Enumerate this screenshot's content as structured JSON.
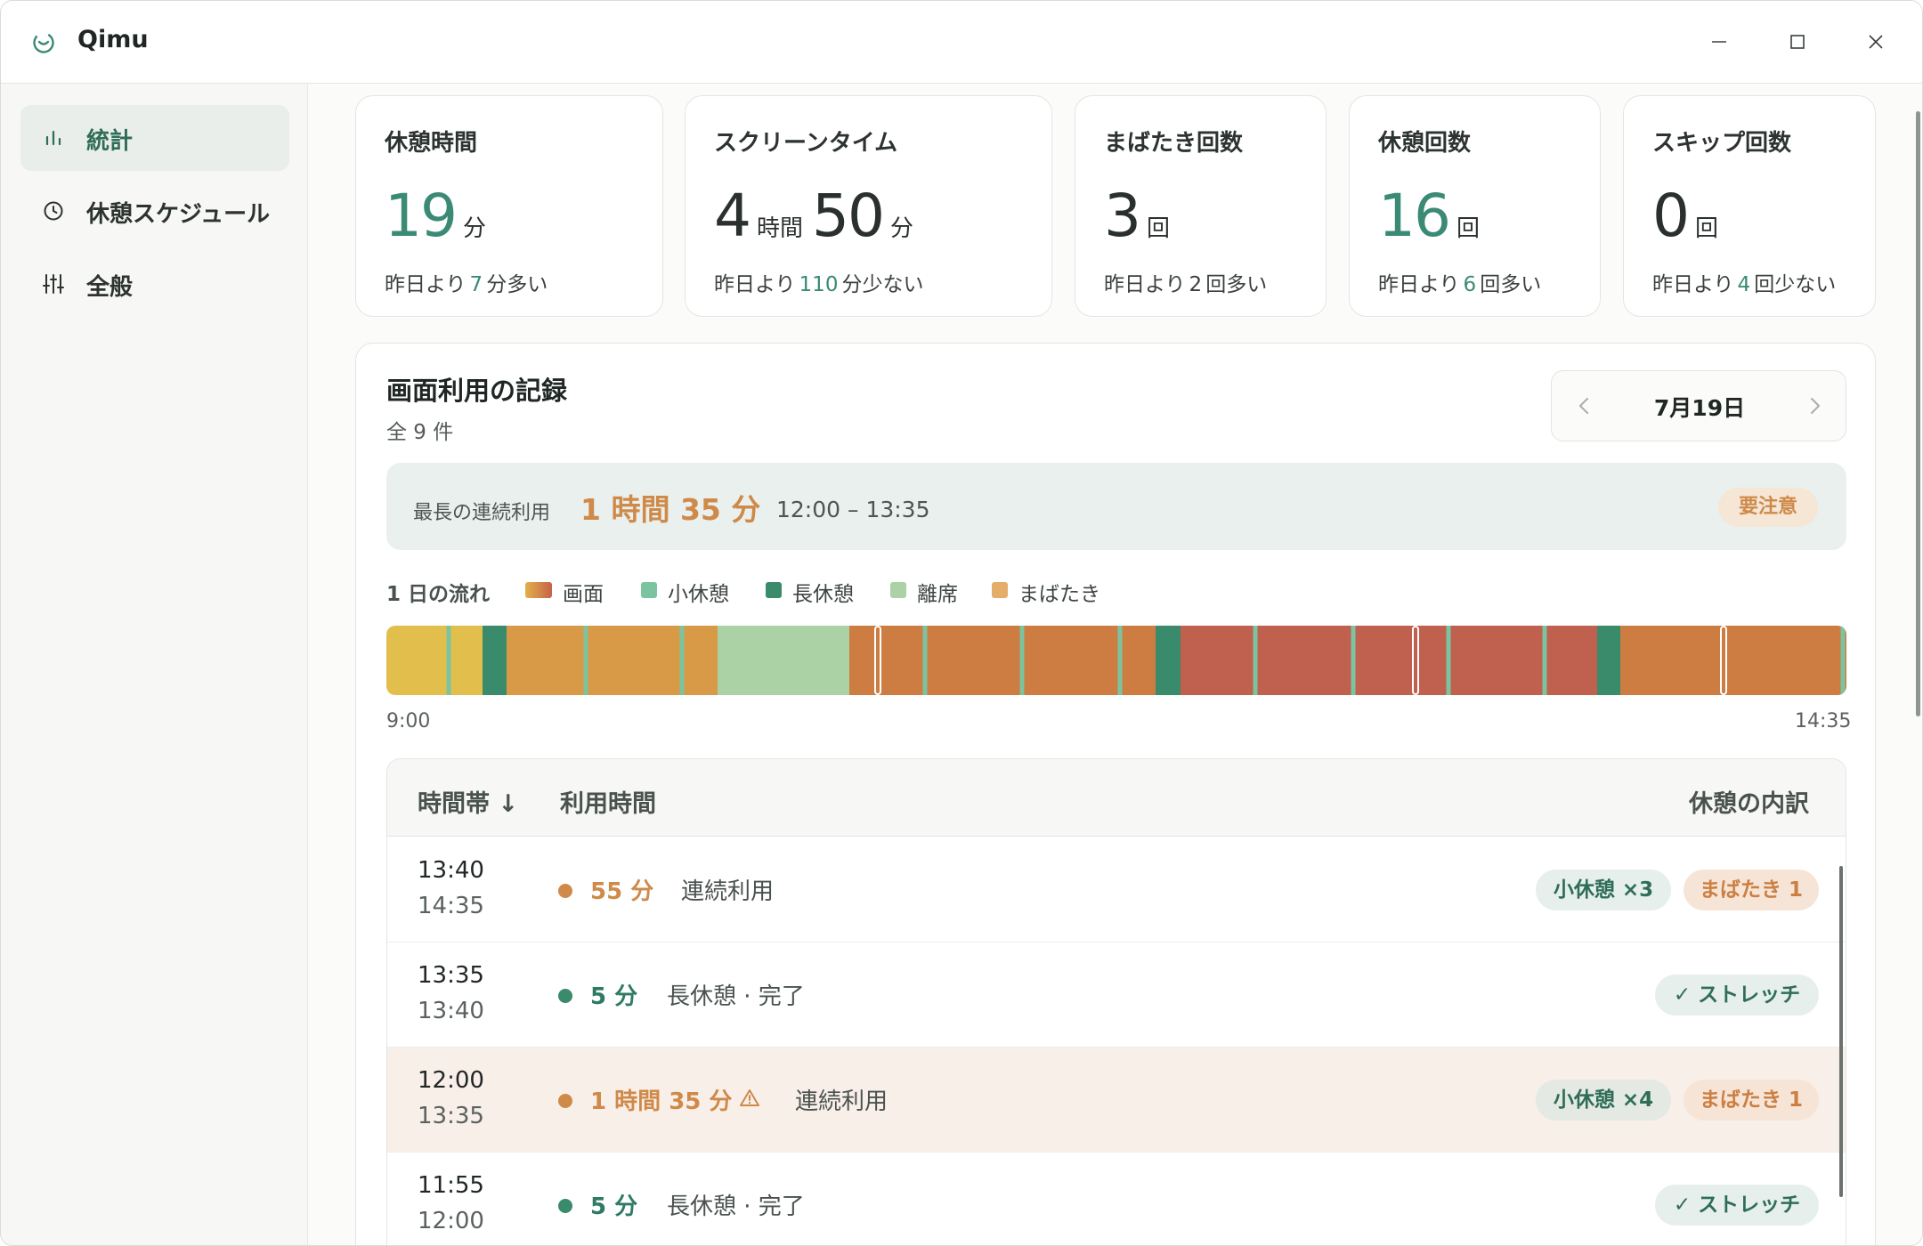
{
  "app": {
    "title": "Qimu"
  },
  "sidebar": {
    "items": [
      {
        "label": "統計",
        "icon": "bar-chart-icon",
        "active": true
      },
      {
        "label": "休憩スケジュール",
        "icon": "clock-icon",
        "active": false
      },
      {
        "label": "全般",
        "icon": "sliders-icon",
        "active": false
      }
    ]
  },
  "stats": [
    {
      "title": "休憩時間",
      "values": [
        {
          "num": "19",
          "unit": "分",
          "accent": true
        }
      ],
      "diff_prefix": "昨日より",
      "diff_value": "7",
      "diff_suffix": "分多い"
    },
    {
      "title": "スクリーンタイム",
      "values": [
        {
          "num": "4",
          "unit": "時間"
        },
        {
          "num": "50",
          "unit": "分"
        }
      ],
      "diff_prefix": "昨日より",
      "diff_value": "110",
      "diff_suffix": "分少ない"
    },
    {
      "title": "まばたき回数",
      "values": [
        {
          "num": "3",
          "unit": "回"
        }
      ],
      "diff_prefix": "昨日より",
      "diff_value": "2",
      "diff_suffix": "回多い"
    },
    {
      "title": "休憩回数",
      "values": [
        {
          "num": "16",
          "unit": "回",
          "accent": true
        }
      ],
      "diff_prefix": "昨日より",
      "diff_value": "6",
      "diff_suffix": "回多い"
    },
    {
      "title": "スキップ回数",
      "values": [
        {
          "num": "0",
          "unit": "回"
        }
      ],
      "diff_prefix": "昨日より",
      "diff_value": "4",
      "diff_suffix": "回少ない"
    }
  ],
  "record": {
    "title": "画面利用の記録",
    "count": "全 9 件",
    "date": "7月19日",
    "longest": {
      "label": "最長の連続利用",
      "value": "1 時間 35 分",
      "range": "12:00 – 13:35",
      "badge": "要注意"
    },
    "flow": {
      "title": "1 日の流れ",
      "legend": [
        {
          "label": "画面",
          "color": "#d9904a"
        },
        {
          "label": "小休憩",
          "color": "#7cc4a0"
        },
        {
          "label": "長休憩",
          "color": "#3a8a6c"
        },
        {
          "label": "離席",
          "color": "#aad2a4"
        },
        {
          "label": "まばたき",
          "color": "#e5ad6a"
        }
      ],
      "start": "9:00",
      "end": "14:35"
    },
    "table": {
      "headers": {
        "time": "時間帯 ↓",
        "usage": "利用時間",
        "breakdown": "休憩の内訳"
      },
      "rows": [
        {
          "start": "13:40",
          "end": "14:35",
          "duration": "55 分",
          "type": "usage",
          "kind": "連続利用",
          "warning": false,
          "tags": [
            {
              "label": "小休憩 ×3",
              "style": "green"
            },
            {
              "label": "まばたき 1",
              "style": "orange"
            }
          ]
        },
        {
          "start": "13:35",
          "end": "13:40",
          "duration": "5 分",
          "type": "break",
          "kind": "長休憩 · 完了",
          "warning": false,
          "tags": [
            {
              "label": "✓ ストレッチ",
              "style": "stretch"
            }
          ]
        },
        {
          "start": "12:00",
          "end": "13:35",
          "duration": "1 時間 35 分",
          "type": "usage",
          "kind": "連続利用",
          "warning": true,
          "tags": [
            {
              "label": "小休憩 ×4",
              "style": "green"
            },
            {
              "label": "まばたき 1",
              "style": "orange"
            }
          ]
        },
        {
          "start": "11:55",
          "end": "12:00",
          "duration": "5 分",
          "type": "break",
          "kind": "長休憩 · 完了",
          "warning": false,
          "tags": [
            {
              "label": "✓ ストレッチ",
              "style": "stretch"
            }
          ]
        }
      ]
    }
  },
  "colors": {
    "accent": "#3a8a76",
    "warning": "#cf8a4a",
    "usage_dot": "#cf8a4a",
    "break_dot": "#3a8a6c"
  }
}
